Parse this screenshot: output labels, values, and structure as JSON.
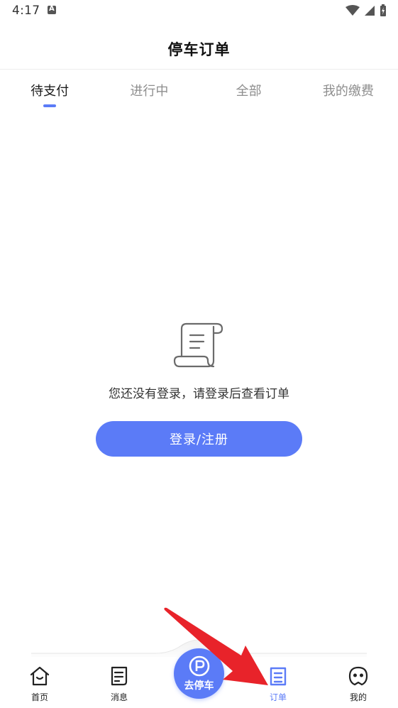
{
  "status_bar": {
    "time": "4:17"
  },
  "header": {
    "title": "停车订单"
  },
  "tabs": [
    {
      "label": "待支付",
      "active": true
    },
    {
      "label": "进行中",
      "active": false
    },
    {
      "label": "全部",
      "active": false
    },
    {
      "label": "我的缴费",
      "active": false
    }
  ],
  "empty_state": {
    "icon": "receipt-scroll-icon",
    "message": "您还没有登录，请登录后查看订单",
    "button_label": "登录/注册"
  },
  "bottom_nav": {
    "items": [
      {
        "label": "首页",
        "icon": "home-icon",
        "active": false
      },
      {
        "label": "消息",
        "icon": "message-icon",
        "active": false
      },
      {
        "label": "订单",
        "icon": "order-icon",
        "active": true
      },
      {
        "label": "我的",
        "icon": "profile-icon",
        "active": false
      }
    ],
    "center": {
      "label": "去停车",
      "icon": "parking-icon"
    }
  },
  "colors": {
    "accent": "#5b7bf7",
    "annotation_arrow": "#e8232a"
  }
}
